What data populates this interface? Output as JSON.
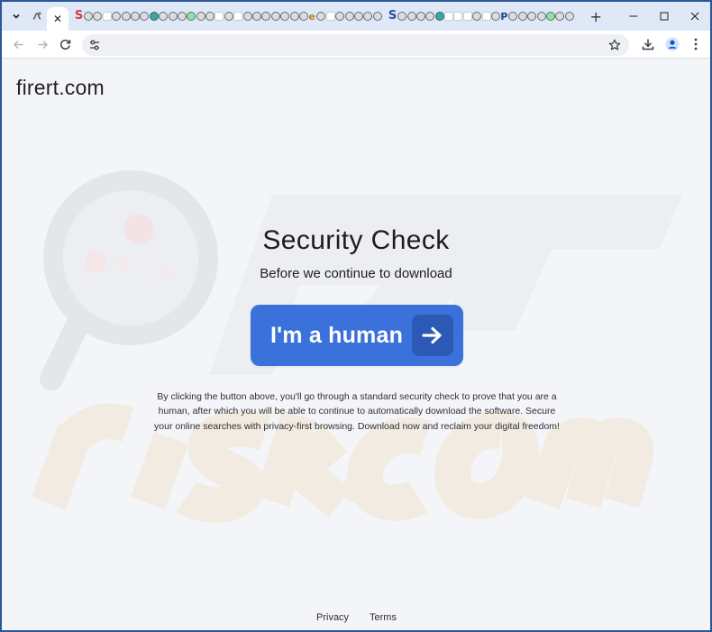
{
  "browser": {
    "active_tab_close_glyph": "✕",
    "new_tab_glyph": "+",
    "address_bar_value": "",
    "controls": {
      "minimize": "—",
      "maximize": "☐",
      "close": "✕"
    },
    "icons": {
      "back": "arrow-left-icon",
      "forward": "arrow-right-icon",
      "reload": "reload-icon",
      "site_settings": "tune-icon",
      "bookmark": "star-icon",
      "downloads": "download-icon",
      "profile": "profile-icon",
      "menu": "kebab-menu-icon"
    }
  },
  "page": {
    "site_name": "firert.com",
    "headline": "Security Check",
    "subheadline": "Before we continue to download",
    "button_label": "I'm a human",
    "disclaimer": "By clicking the button above, you'll go through a standard security check to prove that you are a human, after which you will be able to continue to automatically download the software. Secure your online searches with privacy-first browsing. Download now and reclaim your digital freedom!",
    "footer": {
      "privacy": "Privacy",
      "terms": "Terms"
    },
    "accent_color": "#3b71db"
  }
}
